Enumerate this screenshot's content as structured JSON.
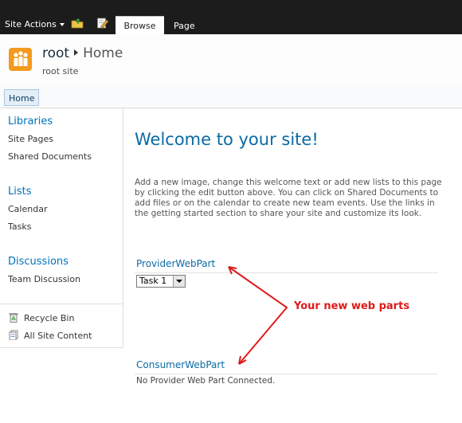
{
  "ribbon": {
    "site_actions": "Site Actions",
    "tabs": [
      {
        "label": "Browse",
        "selected": true
      },
      {
        "label": "Page",
        "selected": false
      }
    ],
    "icons": [
      "navigate-up-icon",
      "edit-page-icon"
    ]
  },
  "titlearea": {
    "breadcrumb_root": "root",
    "breadcrumb_current": "Home",
    "subtitle": "root site"
  },
  "topnav": {
    "home": "Home"
  },
  "quicklaunch": {
    "libraries": {
      "heading": "Libraries",
      "items": [
        "Site Pages",
        "Shared Documents"
      ]
    },
    "lists": {
      "heading": "Lists",
      "items": [
        "Calendar",
        "Tasks"
      ]
    },
    "discussions": {
      "heading": "Discussions",
      "items": [
        "Team Discussion"
      ]
    },
    "recycle_bin": "Recycle Bin",
    "all_site_content": "All Site Content"
  },
  "main": {
    "welcome": "Welcome to your site!",
    "intro": "Add a new image, change this welcome text or add new lists to this page by clicking the edit button above. You can click on Shared Documents to add files or on the calendar to create new team events. Use the links in the getting started section to share your site and customize its look.",
    "provider_title": "ProviderWebPart",
    "provider_select_value": "Task 1",
    "consumer_title": "ConsumerWebPart",
    "consumer_text": "No Provider Web Part Connected.",
    "annotation": "Your new web parts"
  },
  "colors": {
    "accent": "#0b6aa3",
    "ribbon_bg": "#1c1c1c",
    "annotation": "#e01a1a",
    "logo": "#f39a20"
  }
}
